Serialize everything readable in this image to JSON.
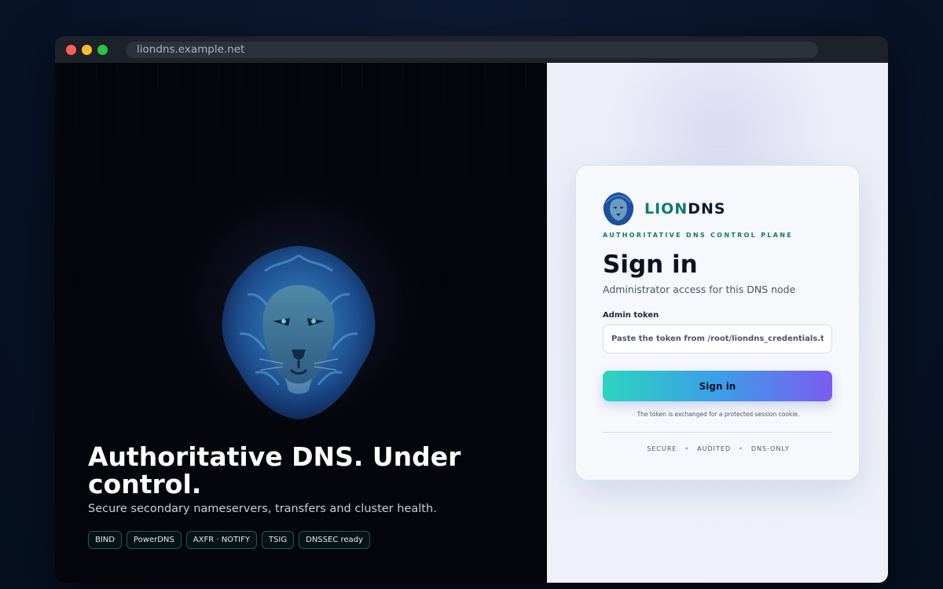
{
  "browser": {
    "url": "liondns.example.net"
  },
  "hero": {
    "title": "Authoritative DNS. Under control.",
    "subtitle": "Secure secondary nameservers, transfers and cluster health.",
    "chips": [
      "BIND",
      "PowerDNS",
      "AXFR · NOTIFY",
      "TSIG",
      "DNSSEC ready"
    ],
    "image_icon": "lion-icon"
  },
  "login": {
    "brand_part1": "LION",
    "brand_part2": "DNS",
    "tagline": "AUTHORITATIVE DNS CONTROL PLANE",
    "title": "Sign in",
    "subtitle": "Administrator access for this DNS node",
    "token_label": "Admin token",
    "token_placeholder": "Paste the token from /root/liondns_credentials.txt",
    "token_value": "",
    "button_label": "Sign in",
    "note": "The token is exchanged for a protected session cookie.",
    "footer_tags": [
      "SECURE",
      "AUDITED",
      "DNS-ONLY"
    ]
  },
  "colors": {
    "accent": "#0f7a6a",
    "button_gradient_start": "#2dd4bf",
    "button_gradient_end": "#7c5cf0",
    "hero_background": "#03050a",
    "panel_background": "#eef1f9"
  }
}
